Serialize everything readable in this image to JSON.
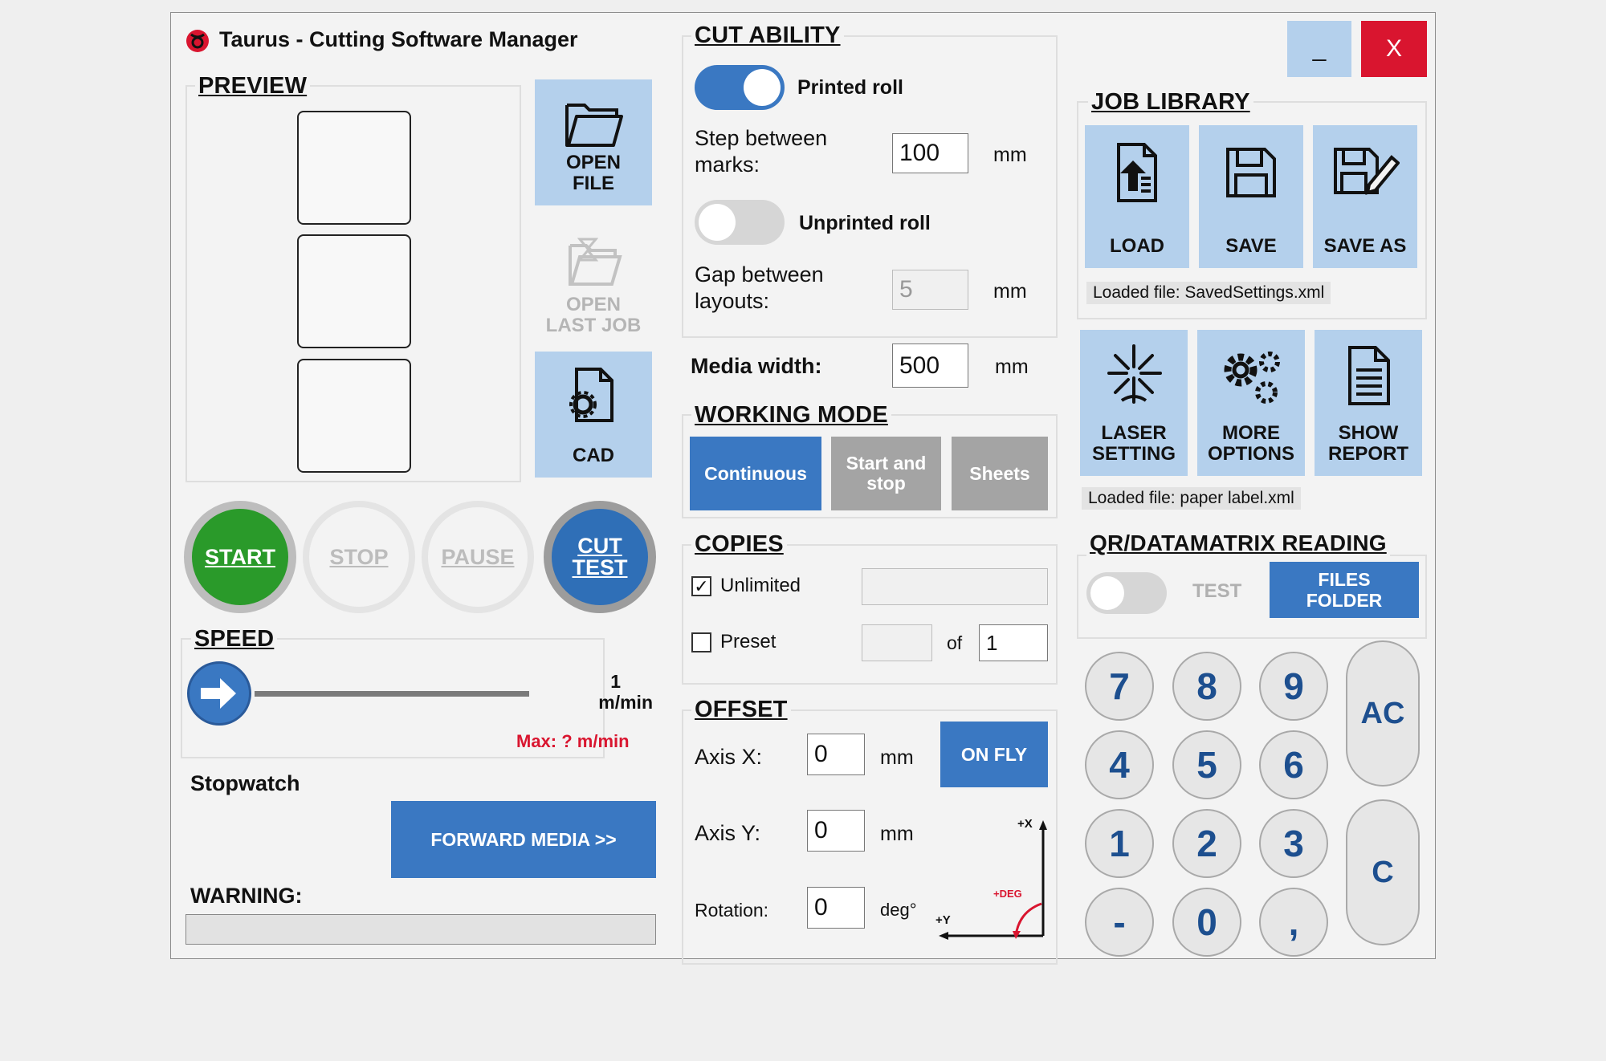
{
  "window": {
    "title": "Taurus - Cutting Software Manager",
    "minimize_label": "_",
    "close_label": "X",
    "colors": {
      "accent": "#3a78c2",
      "tile": "#b4d0ec",
      "close": "#d9152f",
      "warning": "#d9152f"
    }
  },
  "preview": {
    "title": "PREVIEW"
  },
  "file_buttons": {
    "open_file": "OPEN FILE",
    "open_last_job": "OPEN LAST JOB",
    "cad": "CAD"
  },
  "controls": {
    "start": "START",
    "stop": "STOP",
    "pause": "PAUSE",
    "cut_test": "CUT TEST"
  },
  "speed": {
    "title": "SPEED",
    "value": "1",
    "unit": "m/min",
    "max_label": "Max: ? m/min",
    "slider_level": 0
  },
  "stopwatch": {
    "label": "Stopwatch"
  },
  "forward_media": {
    "label": "FORWARD MEDIA >>"
  },
  "warning": {
    "label": "WARNING:"
  },
  "cut_ability": {
    "title": "CUT ABILITY",
    "printed_roll": {
      "label": "Printed roll",
      "on": true
    },
    "step_label": "Step between marks:",
    "step_value": "100",
    "step_unit": "mm",
    "unprinted_roll": {
      "label": "Unprinted roll",
      "on": false
    },
    "gap_label": "Gap between layouts:",
    "gap_value": "5",
    "gap_unit": "mm"
  },
  "media_width": {
    "label": "Media width:",
    "value": "500",
    "unit": "mm"
  },
  "working_mode": {
    "title": "WORKING MODE",
    "continuous": "Continuous",
    "start_stop": "Start and stop",
    "sheets": "Sheets"
  },
  "copies": {
    "title": "COPIES",
    "unlimited_label": "Unlimited",
    "unlimited_checked": "✓",
    "preset_label": "Preset",
    "of_label": "of",
    "of_value": "1"
  },
  "offset": {
    "title": "OFFSET",
    "axis_x_label": "Axis X:",
    "axis_x_value": "0",
    "axis_y_label": "Axis Y:",
    "axis_y_value": "0",
    "rotation_label": "Rotation:",
    "rotation_value": "0",
    "mm": "mm",
    "deg": "deg°",
    "on_fly": "ON FLY",
    "diagram_x": "+X",
    "diagram_y": "+Y",
    "diagram_deg": "+DEG"
  },
  "job_library": {
    "title": "JOB LIBRARY",
    "load": "LOAD",
    "save": "SAVE",
    "save_as": "SAVE AS",
    "loaded_file": "Loaded file: SavedSettings.xml"
  },
  "settings": {
    "laser_setting": "LASER SETTING",
    "more_options": "MORE OPTIONS",
    "show_report": "SHOW REPORT",
    "loaded_file": "Loaded file: paper label.xml"
  },
  "qr": {
    "title": "QR/DATAMATRIX READING",
    "test_label": "TEST",
    "files_folder": "FILES FOLDER",
    "toggle_on": false
  },
  "keypad": {
    "keys": [
      "7",
      "8",
      "9",
      "4",
      "5",
      "6",
      "1",
      "2",
      "3",
      "-",
      "0",
      ","
    ],
    "ac": "AC",
    "c": "C"
  }
}
